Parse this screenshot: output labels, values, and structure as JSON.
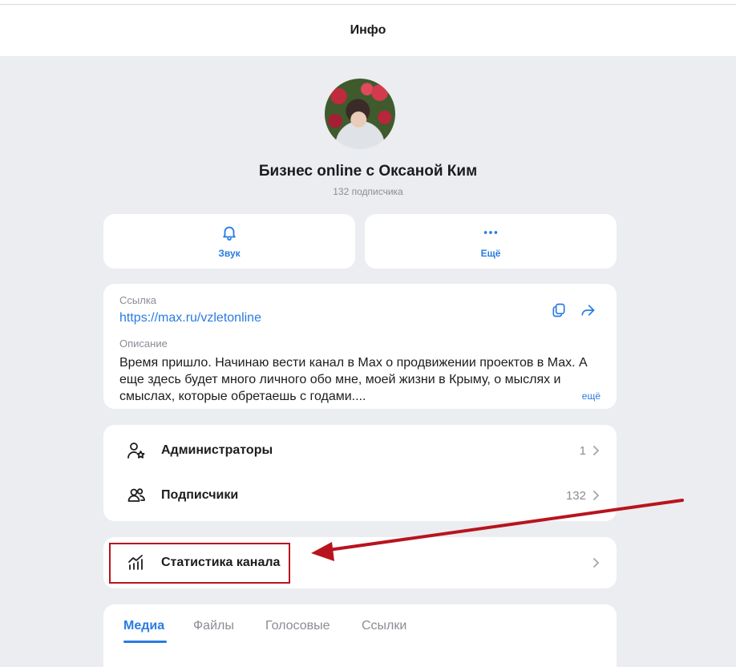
{
  "header": {
    "title": "Инфо"
  },
  "channel": {
    "name": "Бизнес online с Оксаной Ким",
    "subscribers_text": "132 подписчика"
  },
  "actions": {
    "sound_label": "Звук",
    "more_label": "Ещё"
  },
  "info": {
    "link_label": "Ссылка",
    "link_value": "https://max.ru/vzletonline",
    "description_label": "Описание",
    "description_text": "Время пришло. Начинаю вести канал в Мах о продвижении проектов в Мах. А еще здесь будет много личного обо мне, моей жизни в Крыму, о мыслях и смыслах, которые обретаешь с годами....",
    "more_link": "ещё"
  },
  "members": {
    "admins_label": "Администраторы",
    "admins_count": "1",
    "subscribers_label": "Подписчики",
    "subscribers_count": "132"
  },
  "stats": {
    "label": "Статистика канала"
  },
  "tabs": [
    {
      "label": "Медиа",
      "active": true
    },
    {
      "label": "Файлы",
      "active": false
    },
    {
      "label": "Голосовые",
      "active": false
    },
    {
      "label": "Ссылки",
      "active": false
    }
  ],
  "colors": {
    "accent": "#2a7be0",
    "annotation": "#b8141e",
    "background": "#ebedf0"
  },
  "icons": [
    "bell-icon",
    "more-dots-icon",
    "copy-icon",
    "share-icon",
    "admin-star-icon",
    "users-icon",
    "stats-chart-icon",
    "chevron-right-icon"
  ]
}
